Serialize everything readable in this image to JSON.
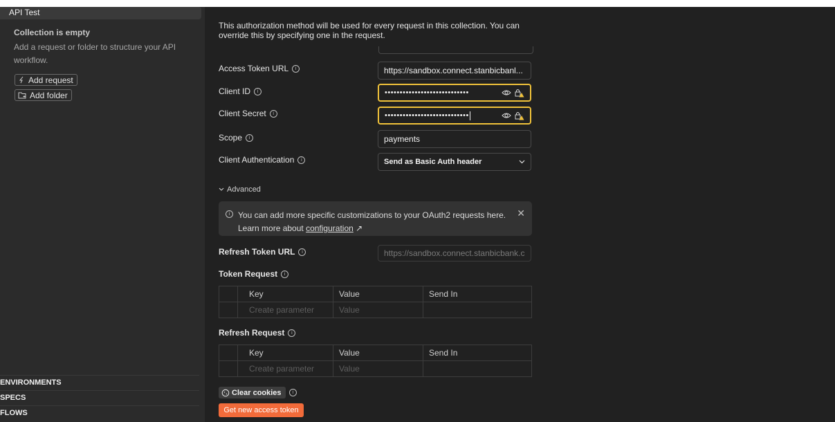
{
  "sidebar": {
    "collection_name": "API Test",
    "empty_title": "Collection is empty",
    "empty_description": "Add a request or folder to structure your API workflow.",
    "add_request_label": "Add request",
    "add_folder_label": "Add folder",
    "sections": [
      "ENVIRONMENTS",
      "SPECS",
      "FLOWS"
    ]
  },
  "main": {
    "info_text": "This authorization method will be used for every request in this collection. You can override this by specifying one in the request.",
    "access_token_url": {
      "label": "Access Token URL",
      "value": "https://sandbox.connect.stanbicbanl..."
    },
    "client_id": {
      "label": "Client ID",
      "value": "••••••••••••••••••••••••••••"
    },
    "client_secret": {
      "label": "Client Secret",
      "value": "••••••••••••••••••••••••••••"
    },
    "scope": {
      "label": "Scope",
      "value": "payments"
    },
    "client_authentication": {
      "label": "Client Authentication",
      "value": "Send as Basic Auth header"
    },
    "advanced_label": "Advanced",
    "banner": {
      "text_line1": "You can add more specific customizations to your OAuth2 requests here.",
      "text_line2_prefix": "Learn more about",
      "link_text": "configuration",
      "link_arrow": "↗"
    },
    "refresh_token_url": {
      "label": "Refresh Token URL",
      "placeholder": "https://sandbox.connect.stanbicbank.c"
    },
    "token_request": {
      "label": "Token Request",
      "headers": [
        "Key",
        "Value",
        "Send In"
      ],
      "placeholders": [
        "Create parameter",
        "Value"
      ]
    },
    "refresh_request": {
      "label": "Refresh Request",
      "headers": [
        "Key",
        "Value",
        "Send In"
      ],
      "placeholders": [
        "Create parameter",
        "Value"
      ]
    },
    "clear_cookies_label": "Clear cookies",
    "get_token_label": "Get new access token"
  },
  "colors": {
    "accent": "#f26b3a",
    "warning_border": "#f0c23a",
    "background": "#212121",
    "sidebar": "#2b2b2b"
  }
}
